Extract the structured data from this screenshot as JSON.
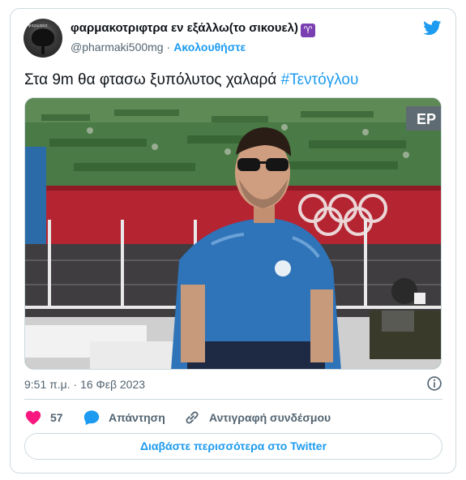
{
  "tweet": {
    "display_name": "φαρμακοτριφτρα εν εξάλλω(το σικουελ)",
    "zodiac_emoji": "♈",
    "handle": "@pharmaki500mg",
    "separator": "·",
    "follow_label": "Ακολουθήστε",
    "text_main": "Στα 9m θα φτασω ξυπόλυτος χαλαρά ",
    "hashtag": "#Τεντόγλου",
    "timestamp": "9:51 π.μ. · 16 Φεβ 2023",
    "likes_count": "57",
    "reply_label": "Απάντηση",
    "copy_link_label": "Αντιγραφή συνδέσμου",
    "read_more_label": "Διαβάστε περισσότερα στο Twitter"
  },
  "media": {
    "scoreboard_text": "EP",
    "avatar_text": "φαρμακο"
  },
  "icons": {
    "logo": "twitter-bird-icon",
    "info": "info-icon",
    "like": "heart-icon",
    "reply": "speech-bubble-icon",
    "copy": "link-icon"
  },
  "colors": {
    "accent": "#1d9bf0",
    "like": "#f91880",
    "text": "#0f1419",
    "muted": "#536471",
    "border": "#cfd9de"
  }
}
